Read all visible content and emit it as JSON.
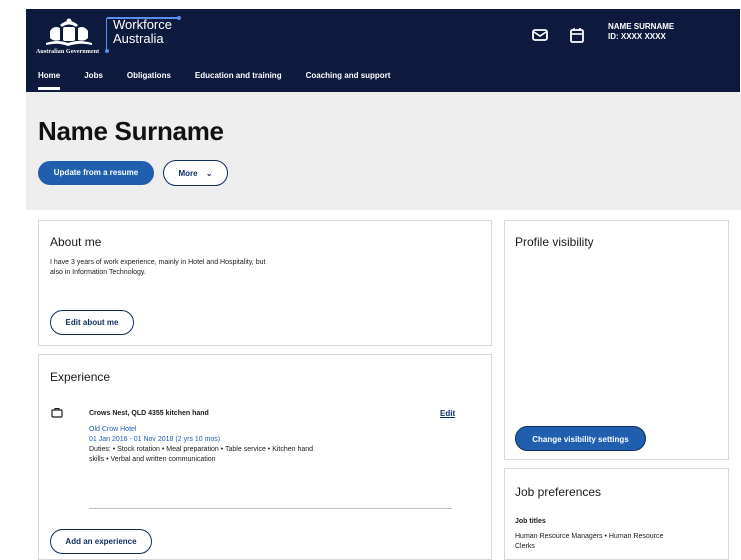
{
  "header": {
    "gov_label": "Australian Government",
    "brand_line1": "Workforce",
    "brand_line2": "Australia",
    "user_name": "NAME SURNAME",
    "user_id": "ID: XXXX XXXX",
    "icons": [
      "mail-icon",
      "calendar-icon"
    ]
  },
  "nav": {
    "items": [
      {
        "label": "Home",
        "active": true
      },
      {
        "label": "Jobs"
      },
      {
        "label": "Obligations"
      },
      {
        "label": "Education and training"
      },
      {
        "label": "Coaching and support"
      }
    ]
  },
  "hero": {
    "title": "Name Surname",
    "update_button": "Update from a resume",
    "more_button": "More"
  },
  "about": {
    "title": "About me",
    "text_line1": "I have 3 years of work experience, mainly in Hotel and Hospitality, but",
    "text_line2": "also in Information Technology.",
    "edit_button": "Edit about me"
  },
  "experience": {
    "title": "Experience",
    "item": {
      "role": "Crows Nest, QLD 4355 kitchen hand",
      "employer": "Old Crow Hotel",
      "dates": "01 Jan 2016 - 01 Nov 2018 (2 yrs 10 mos)",
      "duties_line1": "Duties: • Stock rotation • Meal preparation • Table service • Kitchen hand",
      "duties_line2": "skills • Verbal and written communication",
      "edit_label": "Edit"
    },
    "add_button": "Add an experience"
  },
  "visibility": {
    "title": "Profile visibility",
    "button": "Change visibility settings"
  },
  "preferences": {
    "title": "Job preferences",
    "job_titles_heading": "Job titles",
    "job_titles_line1": "Human Resource Managers •  Human Resource",
    "job_titles_line2": "Clerks"
  }
}
